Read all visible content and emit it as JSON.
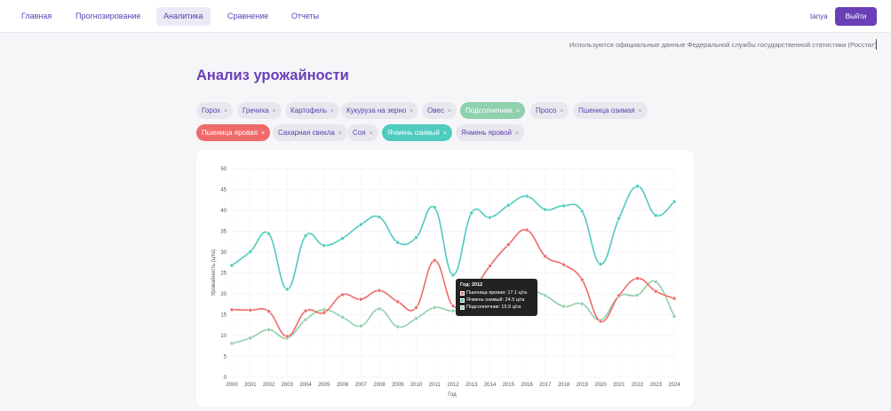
{
  "nav": {
    "items": [
      {
        "label": "Главная"
      },
      {
        "label": "Прогнозирование"
      },
      {
        "label": "Аналитика"
      },
      {
        "label": "Сравнение"
      },
      {
        "label": "Отчеты"
      }
    ],
    "user": "tanya",
    "logout_label": "Выйти"
  },
  "source_note": "Используются официальные данные Федеральной службы государственной статистики (Росстат)",
  "page_title": "Анализ урожайности",
  "chips": [
    {
      "label": "Горох",
      "remove": "×"
    },
    {
      "label": "Гречиха",
      "remove": "×"
    },
    {
      "label": "Картофель",
      "remove": "×"
    },
    {
      "label": "Кукуруза на зерно",
      "remove": "×"
    },
    {
      "label": "Овес",
      "remove": "×"
    },
    {
      "label": "Подсолнечник",
      "remove": "×"
    },
    {
      "label": "Просо",
      "remove": "×"
    },
    {
      "label": "Пшеница озимая",
      "remove": "×"
    },
    {
      "label": "Пшеница яровая",
      "remove": "×"
    },
    {
      "label": "Сахарная свекла",
      "remove": "×"
    },
    {
      "label": "Соя",
      "remove": "×"
    },
    {
      "label": "Ячмень озимый",
      "remove": "×"
    },
    {
      "label": "Ячмень яровой",
      "remove": "×"
    }
  ],
  "colors": {
    "wheat": "#f06a6a",
    "barley": "#4fcbbf",
    "sunflower": "#8fd0ad",
    "accent": "#6a3fb7"
  },
  "chart_data": {
    "type": "line",
    "xlabel": "Год",
    "ylabel": "Урожайность (ц/га)",
    "ylim": [
      0,
      50
    ],
    "yticks": [
      0,
      5,
      10,
      15,
      20,
      25,
      30,
      35,
      40,
      45,
      50
    ],
    "grid": true,
    "x": [
      2000,
      2001,
      2002,
      2003,
      2004,
      2005,
      2006,
      2007,
      2008,
      2009,
      2010,
      2011,
      2012,
      2013,
      2014,
      2015,
      2016,
      2017,
      2018,
      2019,
      2020,
      2021,
      2022,
      2023,
      2024
    ],
    "series": [
      {
        "name": "Пшеница яровая",
        "color": "#f06a6a",
        "values": [
          16.2,
          16.1,
          15.8,
          9.8,
          15.9,
          15.5,
          19.8,
          18.7,
          20.8,
          18.1,
          16.7,
          28.0,
          17.1,
          20.5,
          26.7,
          31.8,
          35.3,
          29.0,
          27.0,
          23.4,
          13.4,
          19.6,
          23.7,
          20.6,
          18.9
        ]
      },
      {
        "name": "Ячмень озимый",
        "color": "#4fcbbf",
        "values": [
          26.8,
          30.1,
          34.4,
          21.1,
          33.9,
          31.6,
          33.3,
          36.6,
          38.4,
          32.3,
          33.5,
          40.7,
          24.5,
          39.4,
          38.3,
          41.2,
          43.4,
          40.2,
          41.1,
          39.8,
          27.1,
          38.1,
          45.8,
          38.8,
          42.1
        ]
      },
      {
        "name": "Подсолнечник",
        "color": "#8fd0ad",
        "values": [
          8.1,
          9.4,
          11.4,
          9.4,
          13.8,
          16.2,
          14.4,
          12.3,
          16.4,
          12.1,
          14.1,
          16.7,
          15.9,
          17.6,
          19.6,
          20.9,
          21.1,
          19.6,
          17.0,
          17.6,
          13.7,
          19.4,
          19.7,
          22.9,
          14.6
        ]
      }
    ],
    "tooltip": {
      "title": "Год: 2012",
      "rows": [
        {
          "text": "Пшеница яровая: 17.1 ц/га",
          "color": "#f06a6a"
        },
        {
          "text": "Ячмень озимый: 24.5 ц/га",
          "color": "#4fcbbf"
        },
        {
          "text": "Подсолнечник: 15.9 ц/га",
          "color": "#8fd0ad"
        }
      ]
    }
  }
}
